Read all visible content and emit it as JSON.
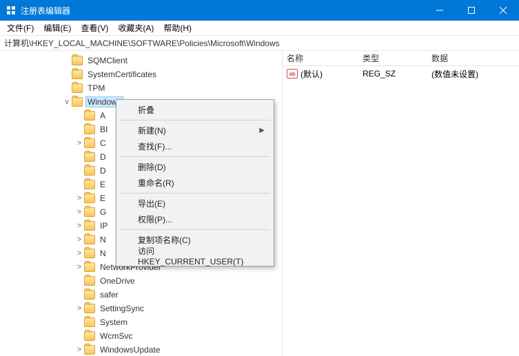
{
  "window": {
    "title": "注册表编辑器"
  },
  "menu": {
    "file": "文件(F)",
    "edit": "编辑(E)",
    "view": "查看(V)",
    "fav": "收藏夹(A)",
    "help": "帮助(H)"
  },
  "address": "计算机\\HKEY_LOCAL_MACHINE\\SOFTWARE\\Policies\\Microsoft\\Windows",
  "columns": {
    "name": "名称",
    "type": "类型",
    "data": "数据"
  },
  "value_row": {
    "icon_text": "ab",
    "name": "(默认)",
    "type": "REG_SZ",
    "data": "(数值未设置)"
  },
  "tree": {
    "above": [
      {
        "indent": 90,
        "tw": "",
        "label": "SQMClient"
      },
      {
        "indent": 90,
        "tw": "",
        "label": "SystemCertificates"
      },
      {
        "indent": 90,
        "tw": "",
        "label": "TPM"
      }
    ],
    "selected": {
      "indent": 90,
      "tw": "v",
      "label": "Windows"
    },
    "children": [
      {
        "indent": 108,
        "tw": "",
        "label": "A"
      },
      {
        "indent": 108,
        "tw": "",
        "label": "BI"
      },
      {
        "indent": 108,
        "tw": ">",
        "label": "C"
      },
      {
        "indent": 108,
        "tw": "",
        "label": "D"
      },
      {
        "indent": 108,
        "tw": "",
        "label": "D"
      },
      {
        "indent": 108,
        "tw": "",
        "label": "E"
      },
      {
        "indent": 108,
        "tw": ">",
        "label": "E"
      },
      {
        "indent": 108,
        "tw": ">",
        "label": "G"
      },
      {
        "indent": 108,
        "tw": ">",
        "label": "IP"
      },
      {
        "indent": 108,
        "tw": ">",
        "label": "N"
      },
      {
        "indent": 108,
        "tw": ">",
        "label": "N"
      }
    ],
    "below": [
      {
        "indent": 108,
        "tw": ">",
        "label": "NetworkProvider"
      },
      {
        "indent": 108,
        "tw": "",
        "label": "OneDrive"
      },
      {
        "indent": 108,
        "tw": "",
        "label": "safer"
      },
      {
        "indent": 108,
        "tw": ">",
        "label": "SettingSync"
      },
      {
        "indent": 108,
        "tw": "",
        "label": "System"
      },
      {
        "indent": 108,
        "tw": "",
        "label": "WcmSvc"
      },
      {
        "indent": 108,
        "tw": ">",
        "label": "WindowsUpdate"
      }
    ]
  },
  "context_menu": {
    "items": [
      {
        "label": "折叠",
        "submenu": false
      },
      {
        "sep": true
      },
      {
        "label": "新建(N)",
        "submenu": true
      },
      {
        "label": "查找(F)...",
        "submenu": false
      },
      {
        "sep": true
      },
      {
        "label": "删除(D)",
        "submenu": false
      },
      {
        "label": "重命名(R)",
        "submenu": false
      },
      {
        "sep": true
      },
      {
        "label": "导出(E)",
        "submenu": false
      },
      {
        "label": "权限(P)...",
        "submenu": false
      },
      {
        "sep": true
      },
      {
        "label": "复制项名称(C)",
        "submenu": false
      },
      {
        "label": "访问 HKEY_CURRENT_USER(T)",
        "submenu": false
      }
    ]
  }
}
